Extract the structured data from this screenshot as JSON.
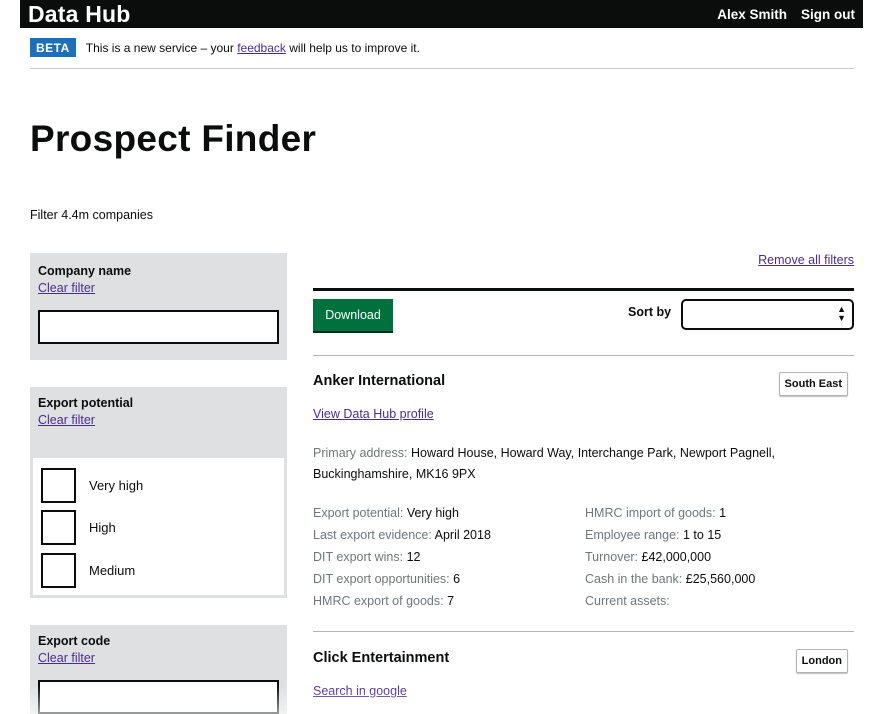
{
  "header": {
    "brand": "Data Hub",
    "user": "Alex Smith",
    "signout": "Sign out"
  },
  "beta": {
    "tag": "BETA",
    "text_before": "This is a new service – your",
    "link": "feedback",
    "text_after": "will help us to improve it."
  },
  "page_title": "Prospect Finder",
  "filter_count": "Filter 4.4m companies",
  "filters": {
    "company_name": {
      "label": "Company name",
      "clear": "Clear filter",
      "value": ""
    },
    "export_potential": {
      "label": "Export potential",
      "clear": "Clear filter",
      "options": [
        "Very high",
        "High",
        "Medium"
      ]
    },
    "export_code": {
      "label": "Export code",
      "clear": "Clear filter",
      "value": ""
    }
  },
  "toolbar": {
    "remove_all": "Remove all filters",
    "download": "Download",
    "sort_label": "Sort by",
    "sort_value": ""
  },
  "results": [
    {
      "name": "Anker International",
      "region": "South East",
      "link": "View Data Hub profile",
      "address_label": "Primary address:",
      "address": "Howard House, Howard Way, Interchange Park, Newport Pagnell, Buckinghamshire, MK16 9PX",
      "left": [
        {
          "label": "Export potential:",
          "value": "Very high"
        },
        {
          "label": "Last export evidence:",
          "value": "April 2018"
        },
        {
          "label": "DIT export wins:",
          "value": "12"
        },
        {
          "label": "DIT export opportunities:",
          "value": "6"
        },
        {
          "label": "HMRC export of goods:",
          "value": "7"
        }
      ],
      "right": [
        {
          "label": "HMRC import of goods:",
          "value": "1"
        },
        {
          "label": "Employee range:",
          "value": "1 to 15"
        },
        {
          "label": "Turnover:",
          "value": "£42,000,000"
        },
        {
          "label": "Cash in the bank:",
          "value": "£25,560,000"
        },
        {
          "label": "Current assets:",
          "value": ""
        }
      ]
    },
    {
      "name": "Click Entertainment",
      "region": "London",
      "link": "Search in google"
    }
  ],
  "colors": {
    "header_bg": "#0b0c0c",
    "beta_blue": "#1d70b8",
    "link_purple": "#4c2c92",
    "button_green": "#00703c",
    "panel_grey": "#dee0e2",
    "label_grey": "#6f777b"
  }
}
